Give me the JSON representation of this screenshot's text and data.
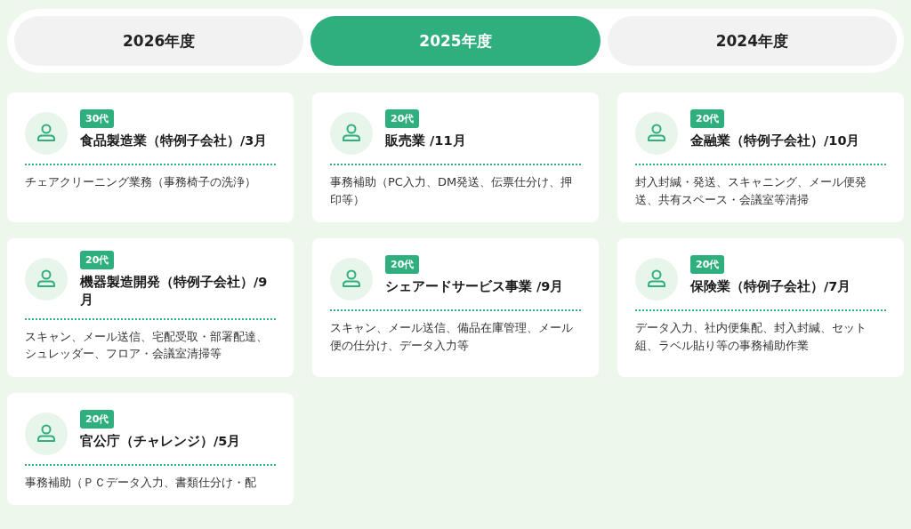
{
  "tabs": [
    {
      "label": "2026年度",
      "selected": false
    },
    {
      "label": "2025年度",
      "selected": true
    },
    {
      "label": "2024年度",
      "selected": false
    }
  ],
  "cards": [
    {
      "age": "30代",
      "title": "食品製造業（特例子会社）/3月",
      "description": "チェアクリーニング業務（事務椅子の洗浄）"
    },
    {
      "age": "20代",
      "title": "販売業 /11月",
      "description": "事務補助（PC入力、DM発送、伝票仕分け、押印等）"
    },
    {
      "age": "20代",
      "title": "金融業（特例子会社）/10月",
      "description": "封入封緘・発送、スキャニング、メール便発送、共有スペース・会議室等清掃"
    },
    {
      "age": "20代",
      "title": "機器製造開発（特例子会社）/9月",
      "description": "スキャン、メール送信、宅配受取・部署配達、シュレッダー、フロア・会議室清掃等"
    },
    {
      "age": "20代",
      "title": "シェアードサービス事業 /9月",
      "description": "スキャン、メール送信、備品在庫管理、メール便の仕分け、データ入力等"
    },
    {
      "age": "20代",
      "title": "保険業（特例子会社）/7月",
      "description": "データ入力、社内便集配、封入封緘、セット組、ラベル貼り等の事務補助作業"
    },
    {
      "age": "20代",
      "title": "官公庁（チャレンジ）/5月",
      "description": "事務補助（ＰＣデータ入力、書類仕分け・配"
    }
  ]
}
